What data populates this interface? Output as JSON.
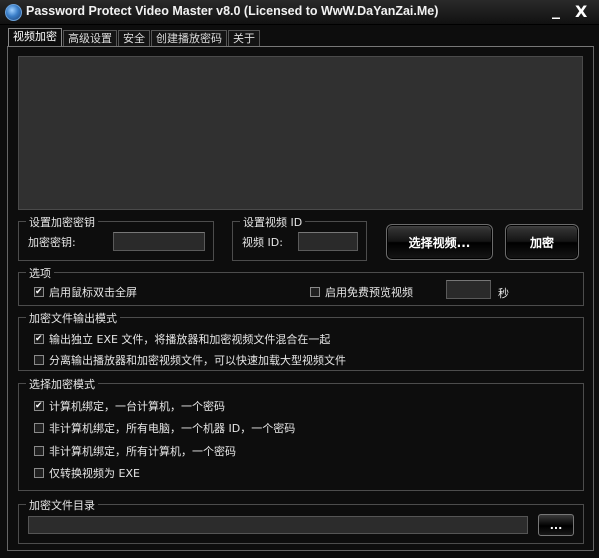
{
  "window": {
    "title": "Password Protect Video Master v8.0 (Licensed to WwW.DaYanZai.Me)",
    "minimize": "_",
    "close": "X"
  },
  "tabs": [
    {
      "label": "视频加密",
      "active": true
    },
    {
      "label": "高级设置",
      "active": false
    },
    {
      "label": "安全",
      "active": false
    },
    {
      "label": "创建播放密码",
      "active": false
    },
    {
      "label": "关于",
      "active": false
    }
  ],
  "key_group": {
    "legend": "设置加密密钥",
    "label": "加密密钥:",
    "value": ""
  },
  "video_id_group": {
    "legend": "设置视频 ID",
    "label": "视频 ID:",
    "value": ""
  },
  "buttons": {
    "select_video": "选择视频...",
    "encrypt": "加密",
    "browse": "..."
  },
  "options": {
    "legend": "选项",
    "fullscreen": {
      "label": "启用鼠标双击全屏",
      "checked": true
    },
    "free_preview": {
      "label": "启用免费预览视频",
      "checked": false
    },
    "preview_seconds": "",
    "seconds_unit": "秒"
  },
  "output_mode": {
    "legend": "加密文件输出模式",
    "items": [
      {
        "label": "输出独立 EXE 文件，将播放器和加密视频文件混合在一起",
        "checked": true
      },
      {
        "label": "分离输出播放器和加密视频文件，可以快速加载大型视频文件",
        "checked": false
      }
    ]
  },
  "encrypt_mode": {
    "legend": "选择加密模式",
    "items": [
      {
        "label": "计算机绑定，一台计算机，一个密码",
        "checked": true
      },
      {
        "label": "非计算机绑定，所有电脑，一个机器 ID，一个密码",
        "checked": false
      },
      {
        "label": "非计算机绑定，所有计算机，一个密码",
        "checked": false
      },
      {
        "label": "仅转换视频为 EXE",
        "checked": false
      }
    ]
  },
  "output_dir": {
    "legend": "加密文件目录",
    "path": ""
  }
}
